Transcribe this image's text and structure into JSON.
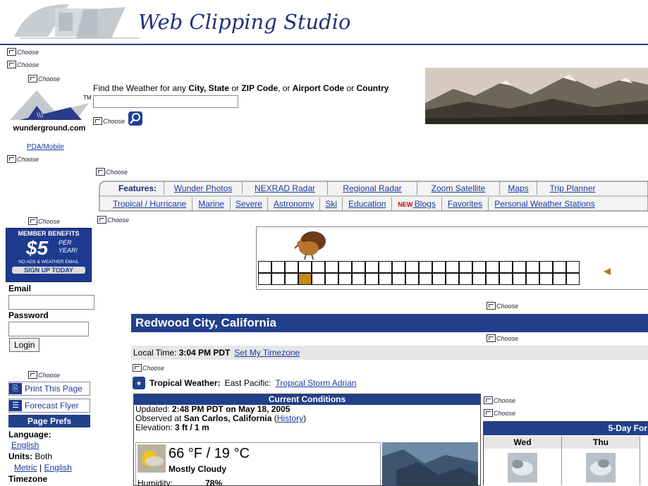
{
  "banner": {
    "title": "Web Clipping Studio"
  },
  "choose_label": "Choose",
  "logo": {
    "tm": "TM",
    "text": "wunderground.com"
  },
  "search": {
    "prompt_parts": [
      "Find the Weather for any ",
      "City, State",
      " or ",
      "ZIP Code",
      ", or ",
      "Airport Code",
      " or ",
      "Country"
    ],
    "value": ""
  },
  "sidebar": {
    "pda_link": "PDA/Mobile",
    "member": {
      "title": "MEMBER BENEFITS",
      "price": "$5",
      "per": "PER",
      "year": "YEAR!",
      "note": "NO ADS & WEATHER EMAIL",
      "cta": "SIGN UP TODAY"
    },
    "email_label": "Email",
    "password_label": "Password",
    "login_label": "Login",
    "print_label": "Print This Page",
    "flyer_label": "Forecast Flyer",
    "prefs_header": "Page Prefs",
    "language_label": "Language:",
    "language_value": "English",
    "units_label": "Units:",
    "units_value": " Both",
    "units_metric": "Metric",
    "units_sep": " | ",
    "units_english": "English",
    "timezone_label": "Timezone"
  },
  "features": {
    "label": "Features:",
    "row1": [
      "Wunder Photos",
      "NEXRAD Radar",
      "Regional Radar",
      "Zoom Satellite",
      "Maps",
      "Trip Planner"
    ],
    "row2": [
      "Tropical / Hurricane",
      "Marine",
      "Severe",
      "Astronomy",
      "Ski",
      "Education",
      "Blogs",
      "Favorites",
      "Personal Weather Stations"
    ],
    "new_badge": "NEW"
  },
  "city": {
    "name": "Redwood City, California"
  },
  "local_time": {
    "label": "Local Time: ",
    "value": "3:04 PM PDT",
    "link": "Set My Timezone"
  },
  "tropical": {
    "label": "Tropical Weather:",
    "region": " East Pacific: ",
    "storm": "Tropical Storm Adrian"
  },
  "conditions": {
    "header": "Current Conditions",
    "updated_label": "Updated: ",
    "updated_value": "2:48 PM PDT on May 18, 2005",
    "observed_label": "Observed at ",
    "observed_value": "San Carlos, California",
    "history_link": "History",
    "elevation_label": "Elevation: ",
    "elevation_value": "3 ft / 1 m",
    "temperature": "66 °F / 19 °C",
    "summary": "Mostly Cloudy",
    "humidity_label": "Humidity:",
    "humidity_value": "78%"
  },
  "forecast": {
    "header": "5-Day For",
    "days": [
      "Wed",
      "Thu"
    ]
  }
}
